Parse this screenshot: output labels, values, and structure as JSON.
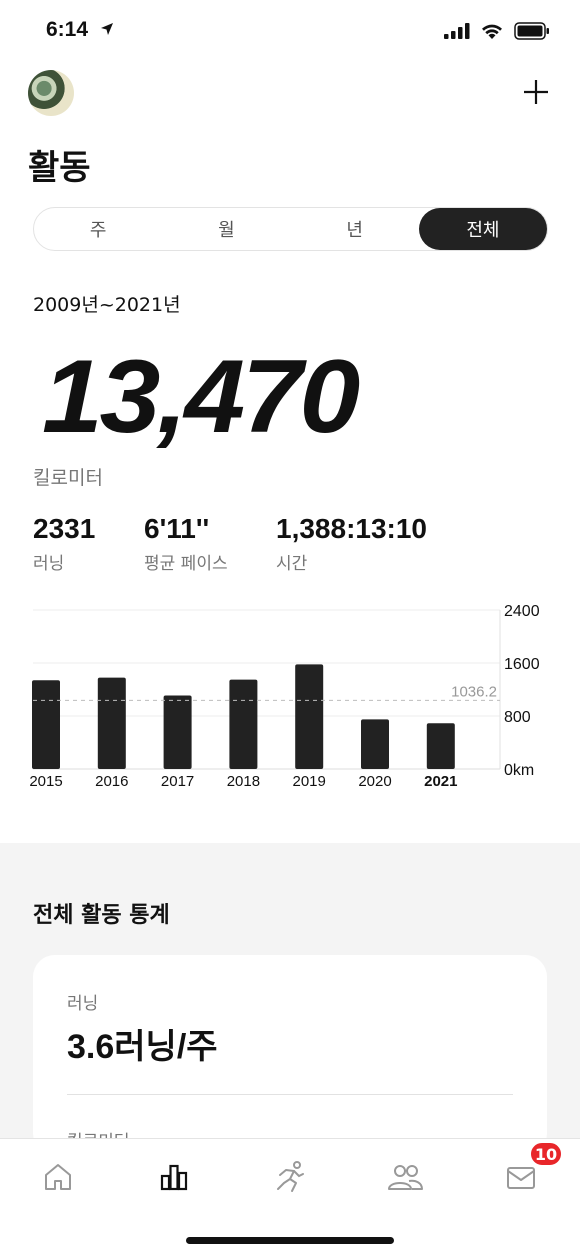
{
  "status": {
    "time": "6:14"
  },
  "page": {
    "title": "활동"
  },
  "tabs": [
    {
      "label": "주",
      "active": false
    },
    {
      "label": "월",
      "active": false
    },
    {
      "label": "년",
      "active": false
    },
    {
      "label": "전체",
      "active": true
    }
  ],
  "summary": {
    "range": "2009년~2021년",
    "total": "13,470",
    "unit": "킬로미터",
    "stats": [
      {
        "value": "2331",
        "label": "러닝"
      },
      {
        "value": "6'11''",
        "label": "평균 페이스"
      },
      {
        "value": "1,388:13:10",
        "label": "시간"
      }
    ]
  },
  "chart_data": {
    "type": "bar",
    "categories": [
      "2015",
      "2016",
      "2017",
      "2018",
      "2019",
      "2020",
      "2021"
    ],
    "values": [
      1340,
      1380,
      1110,
      1350,
      1580,
      750,
      690
    ],
    "highlight_category": "2021",
    "average": 1036.2,
    "average_label": "1036.2",
    "ylim": [
      0,
      2400
    ],
    "yticks": [
      {
        "value": 2400,
        "label": "2400"
      },
      {
        "value": 1600,
        "label": "1600"
      },
      {
        "value": 800,
        "label": "800"
      },
      {
        "value": 0,
        "label": "0km"
      }
    ],
    "bar_color": "#222222",
    "grid": true
  },
  "stats_section": {
    "title": "전체 활동 통계",
    "card": {
      "label": "러닝",
      "value": "3.6러닝/주",
      "next_label": "킬로미터"
    }
  },
  "tab_bar": {
    "items": [
      {
        "name": "home-icon",
        "active": false
      },
      {
        "name": "activity-chart-icon",
        "active": true
      },
      {
        "name": "run-icon",
        "active": false
      },
      {
        "name": "club-icon",
        "active": false
      },
      {
        "name": "inbox-icon",
        "active": false
      }
    ],
    "inbox_badge": "10"
  }
}
